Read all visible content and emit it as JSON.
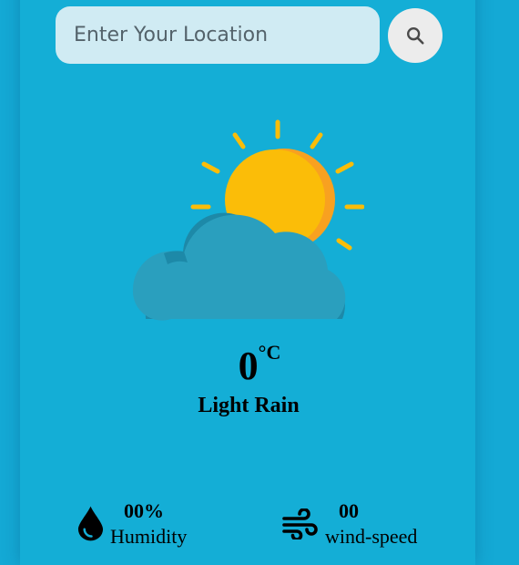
{
  "search": {
    "placeholder": "Enter Your Location",
    "value": ""
  },
  "search_button": {
    "icon": "search-icon"
  },
  "weather": {
    "icon": "partly-cloudy-icon",
    "temperature": "0",
    "unit": "°C",
    "condition": "Light Rain"
  },
  "details": {
    "humidity": {
      "icon": "water-drop-icon",
      "value": "00%",
      "label": "Humidity"
    },
    "wind": {
      "icon": "wind-icon",
      "value": "00",
      "label": "wind-speed"
    }
  },
  "colors": {
    "background": "#14aed6",
    "input_background": "#d0ebf3",
    "button_background": "#ececec",
    "sun": "#fbbd08",
    "sun_shade": "#f8a120",
    "cloud": "#2a9fbe",
    "cloud_shade": "#1d89a8"
  }
}
